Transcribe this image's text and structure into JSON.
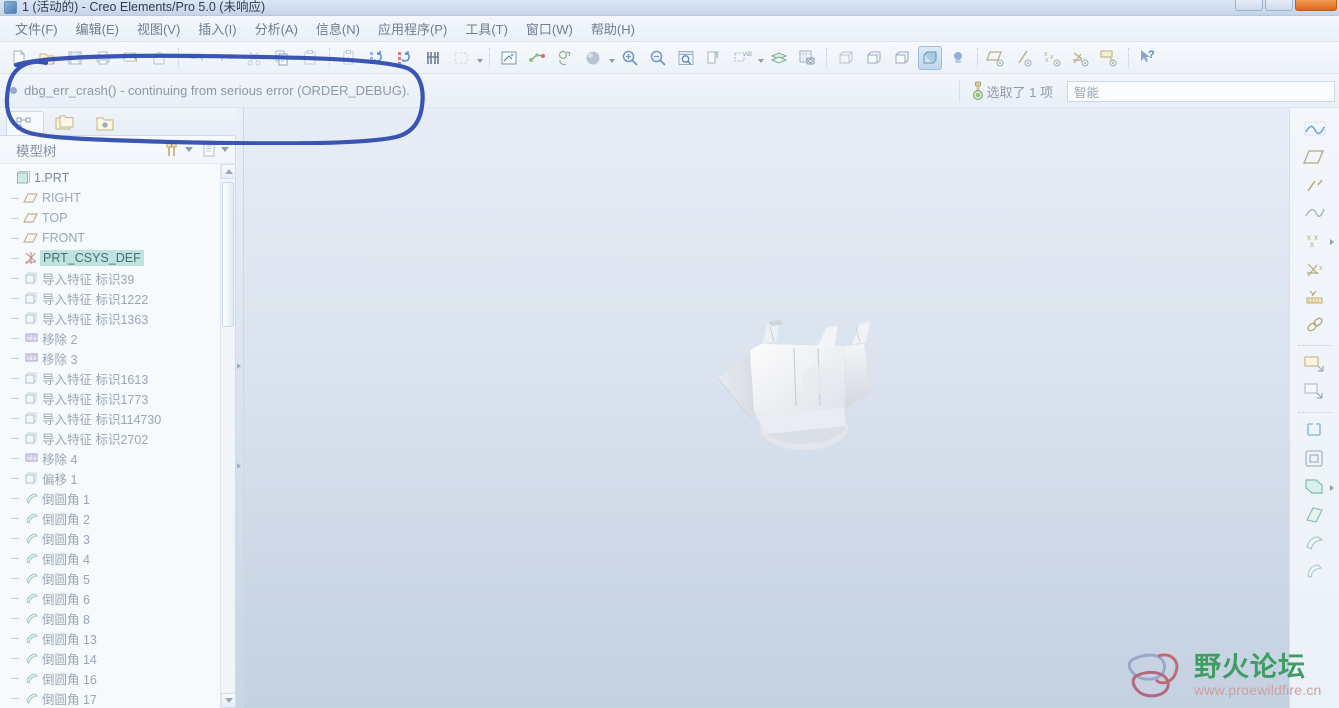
{
  "window": {
    "title": "1 (活动的) - Creo Elements/Pro 5.0 (未响应)",
    "app_icon": "app-icon",
    "buttons": {
      "minimize": "minimize",
      "maximize": "maximize",
      "close": "close"
    }
  },
  "menu": {
    "items": [
      {
        "label": "文件(F)",
        "name": "menu-file"
      },
      {
        "label": "编辑(E)",
        "name": "menu-edit"
      },
      {
        "label": "视图(V)",
        "name": "menu-view"
      },
      {
        "label": "插入(I)",
        "name": "menu-insert"
      },
      {
        "label": "分析(A)",
        "name": "menu-analysis"
      },
      {
        "label": "信息(N)",
        "name": "menu-info"
      },
      {
        "label": "应用程序(P)",
        "name": "menu-applications"
      },
      {
        "label": "工具(T)",
        "name": "menu-tools"
      },
      {
        "label": "窗口(W)",
        "name": "menu-window"
      },
      {
        "label": "帮助(H)",
        "name": "menu-help"
      }
    ]
  },
  "toolbar": {
    "groups": [
      {
        "buttons": [
          {
            "icon": "new-file-icon",
            "name": "new-button"
          },
          {
            "icon": "open-folder-icon",
            "name": "open-button"
          },
          {
            "icon": "save-icon",
            "name": "save-button"
          },
          {
            "icon": "print-icon",
            "name": "print-button"
          },
          {
            "icon": "mail-attach-icon",
            "name": "send-mail-button"
          },
          {
            "icon": "lock-icon",
            "name": "lock-button"
          }
        ]
      },
      {
        "buttons": [
          {
            "icon": "undo-icon",
            "name": "undo-button"
          },
          {
            "icon": "redo-icon",
            "name": "redo-button"
          },
          {
            "icon": "cut-icon",
            "name": "cut-button"
          },
          {
            "icon": "copy-icon",
            "name": "copy-button"
          },
          {
            "icon": "paste-icon",
            "name": "paste-button"
          }
        ]
      },
      {
        "buttons": [
          {
            "icon": "paste-special-icon",
            "name": "paste-special-button"
          },
          {
            "icon": "regenerate-icon",
            "name": "regenerate-button"
          },
          {
            "icon": "regenerate-all-icon",
            "name": "regenerate-all-button"
          },
          {
            "icon": "find-icon",
            "name": "find-button"
          },
          {
            "icon": "select-box-icon",
            "name": "select-box-button"
          }
        ]
      },
      {
        "buttons": [
          {
            "icon": "sketch-icon",
            "name": "sketch-view-button"
          },
          {
            "icon": "point-axis-icon",
            "name": "datum-point-button"
          },
          {
            "icon": "reorient-icon",
            "name": "reorient-button"
          },
          {
            "icon": "shade-sphere-icon",
            "name": "display-style-button",
            "has_caret": true
          },
          {
            "icon": "zoom-in-icon",
            "name": "zoom-in-button"
          },
          {
            "icon": "zoom-out-icon",
            "name": "zoom-out-button"
          },
          {
            "icon": "refit-icon",
            "name": "refit-button"
          },
          {
            "icon": "repaint-icon",
            "name": "repaint-button"
          },
          {
            "icon": "annotate-icon",
            "name": "annotation-button",
            "has_caret": true
          },
          {
            "icon": "layers-icon",
            "name": "layers-button"
          },
          {
            "icon": "capture-icon",
            "name": "capture-image-button"
          }
        ]
      },
      {
        "buttons": [
          {
            "icon": "wireframe-icon",
            "name": "wireframe-button"
          },
          {
            "icon": "hidden-line-icon",
            "name": "hidden-line-button"
          },
          {
            "icon": "no-hidden-icon",
            "name": "no-hidden-button"
          },
          {
            "icon": "shading-icon",
            "name": "shading-button",
            "active": true
          },
          {
            "icon": "light-icon",
            "name": "light-button"
          }
        ]
      },
      {
        "buttons": [
          {
            "icon": "datum-plane-icon",
            "name": "datum-plane-display-button"
          },
          {
            "icon": "datum-axis-icon",
            "name": "datum-axis-display-button"
          },
          {
            "icon": "datum-point-display-icon",
            "name": "datum-point-display-button"
          },
          {
            "icon": "csys-display-icon",
            "name": "csys-display-button"
          },
          {
            "icon": "annotation-display-icon",
            "name": "annotation-display-button"
          }
        ]
      },
      {
        "buttons": [
          {
            "icon": "help-arrow-icon",
            "name": "context-help-button"
          }
        ]
      }
    ]
  },
  "message_bar": {
    "text": "dbg_err_crash() - continuing from serious error (ORDER_DEBUG).",
    "bullet": "bullet-icon"
  },
  "status": {
    "selection_icon": "selection-filter-icon",
    "selection_text": "选取了  1  项",
    "filter_value": "智能"
  },
  "navigator": {
    "tabs": [
      {
        "icon": "model-tree-icon",
        "name": "nav-tab-model-tree",
        "selected": true
      },
      {
        "icon": "folder-browser-icon",
        "name": "nav-tab-folder-browser",
        "selected": false
      },
      {
        "icon": "favorites-folder-icon",
        "name": "nav-tab-favorites",
        "selected": false
      }
    ]
  },
  "model_tree": {
    "title": "模型树",
    "header_buttons": [
      {
        "icon": "filter-icon",
        "name": "tree-filter-button"
      },
      {
        "icon": "settings-list-icon",
        "name": "tree-settings-button"
      }
    ],
    "items": [
      {
        "label": "1.PRT",
        "icon": "part-icon",
        "depth": 0,
        "selected": false
      },
      {
        "label": "RIGHT",
        "icon": "plane-icon",
        "depth": 1,
        "selected": false
      },
      {
        "label": "TOP",
        "icon": "plane-icon",
        "depth": 1,
        "selected": false
      },
      {
        "label": "FRONT",
        "icon": "plane-icon",
        "depth": 1,
        "selected": false
      },
      {
        "label": "PRT_CSYS_DEF",
        "icon": "csys-icon",
        "depth": 1,
        "selected": true
      },
      {
        "label": "导入特征 标识39",
        "icon": "import-icon",
        "depth": 1,
        "selected": false
      },
      {
        "label": "导入特征 标识1222",
        "icon": "import-icon",
        "depth": 1,
        "selected": false
      },
      {
        "label": "导入特征 标识1363",
        "icon": "import-icon",
        "depth": 1,
        "selected": false
      },
      {
        "label": "移除 2",
        "icon": "remove-icon",
        "depth": 1,
        "selected": false
      },
      {
        "label": "移除 3",
        "icon": "remove-icon",
        "depth": 1,
        "selected": false
      },
      {
        "label": "导入特征 标识1613",
        "icon": "import-icon",
        "depth": 1,
        "selected": false
      },
      {
        "label": "导入特征 标识1773",
        "icon": "import-icon",
        "depth": 1,
        "selected": false
      },
      {
        "label": "导入特征 标识114730",
        "icon": "import-icon",
        "depth": 1,
        "selected": false
      },
      {
        "label": "导入特征 标识2702",
        "icon": "import-icon",
        "depth": 1,
        "selected": false
      },
      {
        "label": "移除 4",
        "icon": "remove-icon",
        "depth": 1,
        "selected": false
      },
      {
        "label": "偏移 1",
        "icon": "import-icon",
        "depth": 1,
        "selected": false
      },
      {
        "label": "倒圆角 1",
        "icon": "round-icon",
        "depth": 1,
        "selected": false
      },
      {
        "label": "倒圆角 2",
        "icon": "round-icon",
        "depth": 1,
        "selected": false
      },
      {
        "label": "倒圆角 3",
        "icon": "round-icon",
        "depth": 1,
        "selected": false
      },
      {
        "label": "倒圆角 4",
        "icon": "round-icon",
        "depth": 1,
        "selected": false
      },
      {
        "label": "倒圆角 5",
        "icon": "round-icon",
        "depth": 1,
        "selected": false
      },
      {
        "label": "倒圆角 6",
        "icon": "round-icon",
        "depth": 1,
        "selected": false
      },
      {
        "label": "倒圆角 8",
        "icon": "round-icon",
        "depth": 1,
        "selected": false
      },
      {
        "label": "倒圆角 13",
        "icon": "round-icon",
        "depth": 1,
        "selected": false
      },
      {
        "label": "倒圆角 14",
        "icon": "round-icon",
        "depth": 1,
        "selected": false
      },
      {
        "label": "倒圆角 16",
        "icon": "round-icon",
        "depth": 1,
        "selected": false
      },
      {
        "label": "倒圆角 17",
        "icon": "round-icon",
        "depth": 1,
        "selected": false
      }
    ]
  },
  "right_toolbar": {
    "buttons": [
      {
        "icon": "curve-icon",
        "name": "create-curve-button"
      },
      {
        "icon": "datum-plane-icon",
        "name": "create-datum-plane-button"
      },
      {
        "icon": "datum-axis-icon",
        "name": "create-datum-axis-button"
      },
      {
        "icon": "sketch-curve-icon",
        "name": "create-sketch-button"
      },
      {
        "icon": "datum-point-icon",
        "name": "create-datum-point-button",
        "has_arrow": true
      },
      {
        "icon": "csys-icon",
        "name": "create-csys-button"
      },
      {
        "icon": "analysis-point-icon",
        "name": "analysis-feature-button"
      },
      {
        "icon": "chain-icon",
        "name": "reference-chain-button"
      },
      {
        "sep": true
      },
      {
        "icon": "extrude-icon",
        "name": "extrude-button"
      },
      {
        "icon": "revolve-icon",
        "name": "revolve-button"
      },
      {
        "sep": true
      },
      {
        "icon": "sweep-icon",
        "name": "sweep-button"
      },
      {
        "icon": "hole-icon",
        "name": "hole-button"
      },
      {
        "icon": "shell-icon",
        "name": "shell-button",
        "has_arrow": true
      },
      {
        "icon": "rib-icon",
        "name": "rib-button"
      },
      {
        "icon": "draft-icon",
        "name": "draft-button"
      },
      {
        "icon": "round-icon",
        "name": "round-button"
      }
    ]
  },
  "watermark": {
    "logo": "butterfly-logo-icon",
    "title": "野火论坛",
    "url": "www.proewildfire.cn",
    "title_color": "#3f9c63",
    "url_color": "#cc9f9f"
  },
  "annotation": {
    "type": "hand-drawn-ellipse",
    "color": "#2a46ad",
    "description": "blue ink ellipse circling the message bar"
  }
}
